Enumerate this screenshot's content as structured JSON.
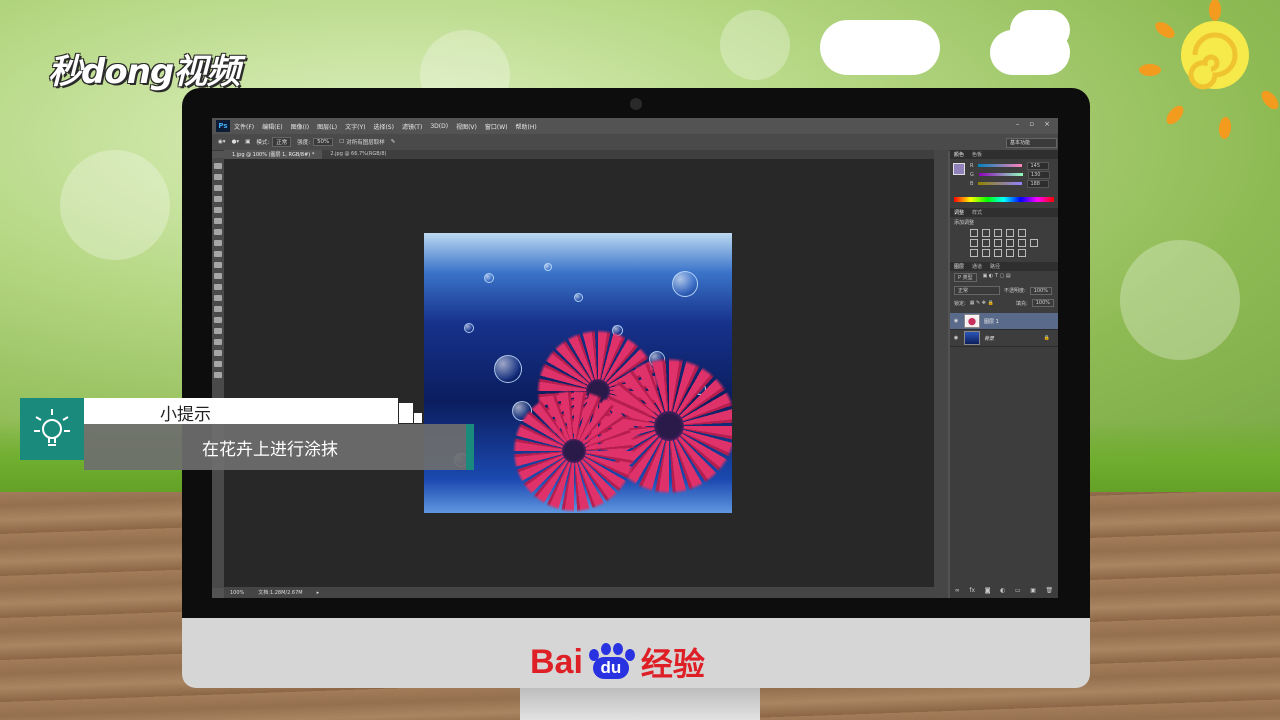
{
  "brand": {
    "logo_text": "秒dong视频",
    "footer_brand_bai": "Bai",
    "footer_brand_du": "du",
    "footer_brand_jingyan": "经验"
  },
  "photoshop": {
    "app_icon": "Ps",
    "menus": [
      "文件(F)",
      "编辑(E)",
      "图像(I)",
      "图层(L)",
      "文字(Y)",
      "选择(S)",
      "滤镜(T)",
      "3D(D)",
      "视图(V)",
      "窗口(W)",
      "帮助(H)"
    ],
    "window_buttons": [
      "–",
      "▫",
      "×"
    ],
    "options_bar": {
      "mode_label": "模式:",
      "mode_value": "正常",
      "flow_label": "强度:",
      "flow_value": "50%",
      "sample_all_layers": "对所有图层取样"
    },
    "workspace": "基本功能",
    "tabs": [
      "1.jpg @ 100% (图层 1, RGB/8#) *",
      "2.jpg @ 66.7%(RGB/8)"
    ],
    "status": {
      "zoom": "100%",
      "doc": "文档:1.28M/2.67M"
    },
    "color_panel": {
      "tabs": [
        "颜色",
        "色板"
      ],
      "channels": [
        {
          "label": "R",
          "value": "145"
        },
        {
          "label": "G",
          "value": "130"
        },
        {
          "label": "B",
          "value": "188"
        }
      ]
    },
    "adjust_panel": {
      "tabs": [
        "调整",
        "样式"
      ],
      "title": "添加调整"
    },
    "layers_panel": {
      "tabs": [
        "图层",
        "通道",
        "路径"
      ],
      "filter_label": "P 类型",
      "blend_mode": "正常",
      "opacity_label": "不透明度:",
      "opacity_value": "100%",
      "lock_label": "锁定:",
      "fill_label": "填充:",
      "fill_value": "100%",
      "layers": [
        {
          "name": "图层 1",
          "selected": true
        },
        {
          "name": "背景",
          "selected": false
        }
      ]
    }
  },
  "tip": {
    "title": "小提示",
    "body": "在花卉上进行涂抹"
  },
  "colors": {
    "tip_accent": "#1a8a7c",
    "baidu_red": "#de1f26",
    "baidu_blue": "#2932e1"
  }
}
